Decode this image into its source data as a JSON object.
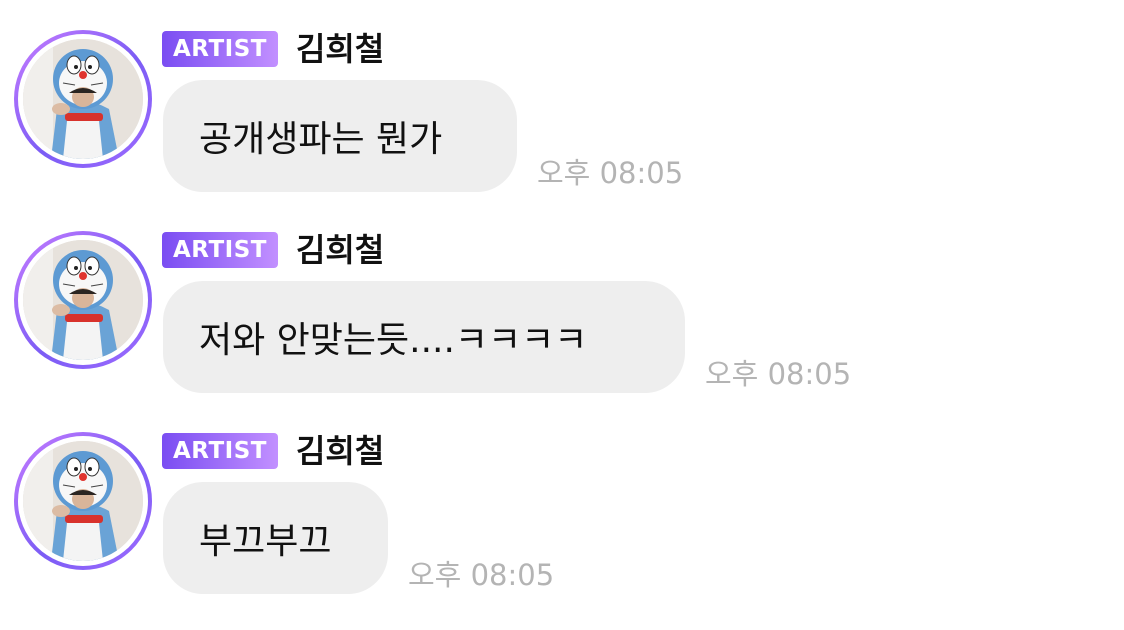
{
  "messages": [
    {
      "badge": "ARTIST",
      "sender": "김희철",
      "text": "공개생파는 뭔가",
      "time": "오후 08:05"
    },
    {
      "badge": "ARTIST",
      "sender": "김희철",
      "text": "저와 안맞는듯....ㅋㅋㅋㅋ",
      "time": "오후 08:05"
    },
    {
      "badge": "ARTIST",
      "sender": "김희철",
      "text": "부끄부끄",
      "time": "오후 08:05"
    }
  ],
  "colors": {
    "bubble": "#eeeeee",
    "badge_start": "#7a4df2",
    "badge_end": "#c290ff",
    "timestamp": "#b4b4b4",
    "avatar_ring": "#9f6bff"
  },
  "icons": {
    "avatar": "profile-photo-blue-cat-costume"
  }
}
